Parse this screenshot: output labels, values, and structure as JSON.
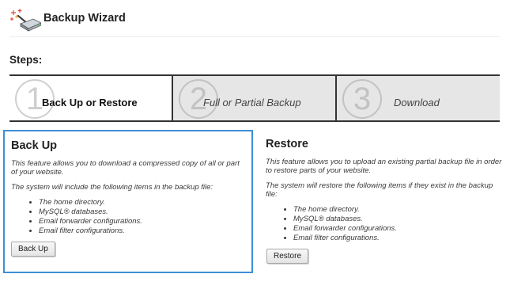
{
  "header": {
    "title": "Backup Wizard",
    "icon": "backup-wizard-icon"
  },
  "steps": {
    "heading": "Steps:",
    "items": [
      {
        "number": "1",
        "label": "Back Up or Restore",
        "active": true
      },
      {
        "number": "2",
        "label": "Full or Partial Backup",
        "active": false
      },
      {
        "number": "3",
        "label": "Download",
        "active": false
      }
    ]
  },
  "backup": {
    "title": "Back Up",
    "description": "This feature allows you to download a compressed copy of all or part of your website.",
    "items_intro": "The system will include the following items in the backup file:",
    "items": [
      "The home directory.",
      "MySQL® databases.",
      "Email forwarder configurations.",
      "Email filter configurations."
    ],
    "button_label": "Back Up"
  },
  "restore": {
    "title": "Restore",
    "description": "This feature allows you to upload an existing partial backup file in order to restore parts of your website.",
    "items_intro": "The system will restore the following items if they exist in the backup file:",
    "items": [
      "The home directory.",
      "MySQL® databases.",
      "Email forwarder configurations.",
      "Email filter configurations."
    ],
    "button_label": "Restore"
  },
  "colors": {
    "selected_border": "#3d8fd6",
    "inactive_step_bg": "#e6e6e6",
    "step_number": "#cfcfcf"
  }
}
